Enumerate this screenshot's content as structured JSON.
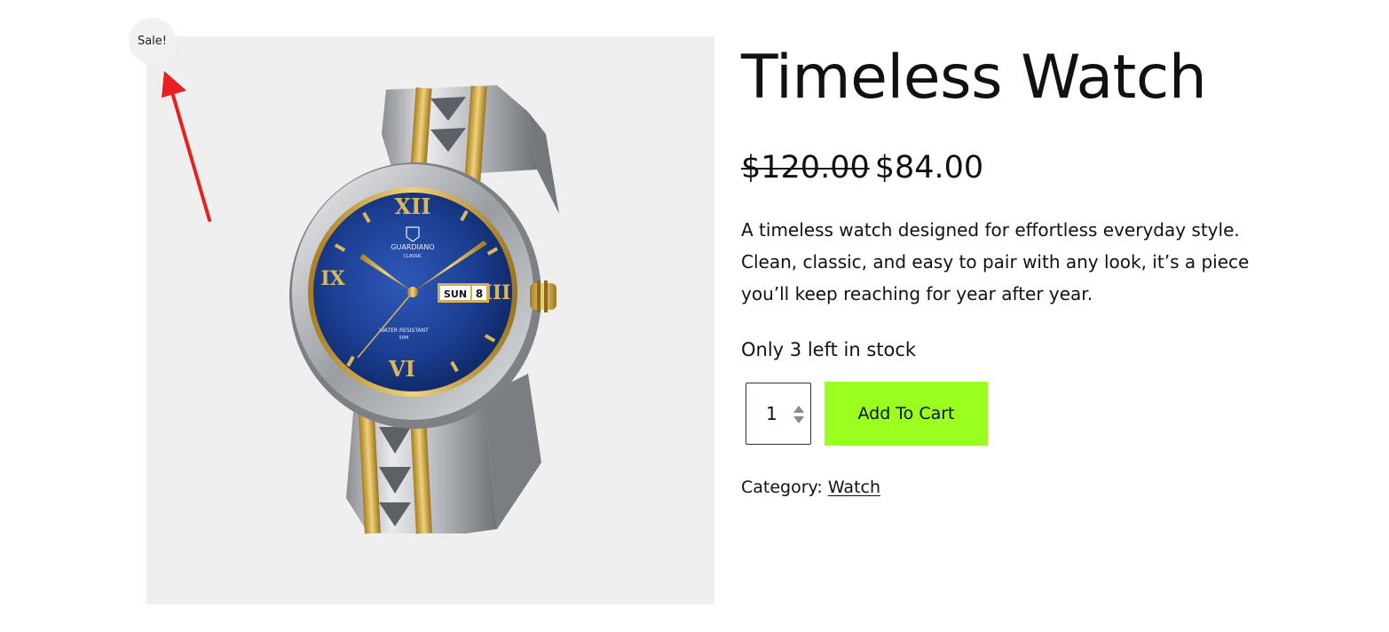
{
  "product": {
    "sale_badge": "Sale!",
    "title": "Timeless Watch",
    "price": {
      "regular": "$120.00",
      "sale": "$84.00"
    },
    "description": "A timeless watch designed for effortless everyday style. Clean, classic, and easy to pair with any look, it’s a piece you’ll keep reaching for year after year.",
    "stock": "Only 3 left in stock",
    "quantity": "1",
    "add_to_cart_label": "Add To Cart",
    "category_label": "Category:",
    "category_link": "Watch"
  },
  "image": {
    "dial_brand": "GUARDIANO",
    "dial_sub": "CLASSIC",
    "dial_day": "SUN",
    "dial_date": "8",
    "dial_water": "WATER RESISTANT",
    "dial_depth": "50M",
    "numeral_12": "XII",
    "numeral_3": "III",
    "numeral_6": "VI",
    "numeral_9": "IX"
  },
  "colors": {
    "accent_button": "#9afe1e",
    "dial_blue": "#1e3a8a",
    "gold": "#c9a33a",
    "annotation_arrow": "#e8201f"
  }
}
